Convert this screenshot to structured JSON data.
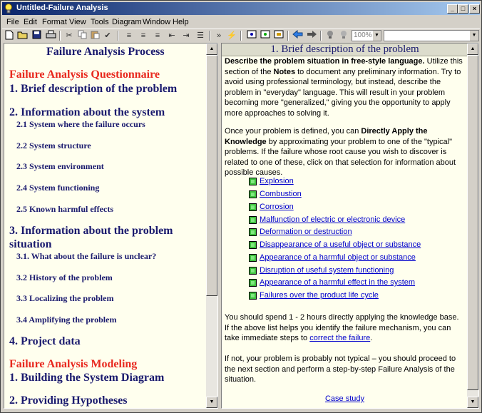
{
  "window": {
    "title": "Untitled-Failure Analysis",
    "minimize": "_",
    "maximize": "□",
    "close": "×"
  },
  "menu": [
    "File",
    "Edit",
    "Format",
    "View",
    "Tools",
    "Diagram",
    "Window",
    "Help"
  ],
  "toolbar": {
    "zoom_value": "100%",
    "search_value": "",
    "icons": [
      "new-icon",
      "open-icon",
      "save-icon",
      "print-icon",
      "cut-icon",
      "copy-icon",
      "paste-icon",
      "spellcheck-icon",
      "align-left-icon",
      "align-center-icon",
      "align-right-icon",
      "outdent-icon",
      "indent-icon",
      "bullets-icon",
      "forward-icon",
      "lightning-icon",
      "browse-icon",
      "browse-back-icon",
      "browse-next-icon",
      "back-arrow-icon",
      "forward-arrow-icon",
      "bulb-icon",
      "bulb-off-icon"
    ]
  },
  "left_pane": {
    "title": "Failure Analysis Process",
    "sections": [
      {
        "kind": "red",
        "text": "Failure Analysis Questionnaire"
      },
      {
        "kind": "sec",
        "text": "1. Brief description of the problem"
      },
      {
        "kind": "sec",
        "text": "2. Information about the system"
      },
      {
        "kind": "sub",
        "text": "2.1 System where the failure occurs"
      },
      {
        "kind": "sub",
        "text": "2.2 System structure"
      },
      {
        "kind": "sub",
        "text": "2.3 System environment"
      },
      {
        "kind": "sub",
        "text": "2.4 System functioning"
      },
      {
        "kind": "sub",
        "text": "2.5 Known harmful effects"
      },
      {
        "kind": "sec",
        "text": "3. Information about the problem"
      },
      {
        "kind": "sec",
        "text": "situation"
      },
      {
        "kind": "sub",
        "text": "3.1. What about the failure is unclear?"
      },
      {
        "kind": "sub",
        "text": "3.2 History of the problem"
      },
      {
        "kind": "sub",
        "text": "3.3 Localizing the problem"
      },
      {
        "kind": "sub",
        "text": "3.4 Amplifying the problem"
      },
      {
        "kind": "sec",
        "text": "4. Project data"
      },
      {
        "kind": "red",
        "text": "Failure Analysis Modeling"
      },
      {
        "kind": "sec",
        "text": "1. Building the System Diagram"
      },
      {
        "kind": "sec",
        "text": "2. Providing Hypotheses"
      }
    ]
  },
  "right_pane": {
    "header": "1. Brief description of the problem",
    "p1_bold": "Describe the problem situation in free-style language.",
    "p1_a": " Utilize this section of the ",
    "p1_notes": "Notes",
    "p1_b": " to document any preliminary information. Try to avoid using professional terminology, but instead, describe the problem in \"everyday\" language. This will result in your problem becoming more \"generalized,\" giving you the opportunity to apply more approaches to solving it.",
    "p2_a": "Once your problem is defined, you can ",
    "p2_bold": "Directly Apply the Knowledge",
    "p2_b": " by approximating your problem to one of the \"typical\" problems. If the failure whose root cause you wish to discover is related to one of these, click on that selection for information about possible causes.",
    "links": [
      "Explosion",
      "Combustion",
      "Corrosion",
      "Malfunction of electric or electronic device",
      "Deformation or destruction",
      "Disappearance of a useful object or substance",
      "Appearance of a harmful object or substance",
      "Disruption of useful system functioning",
      "Appearance of a harmful effect in the system",
      "Failures over the product life cycle"
    ],
    "p3_a": "You should spend 1 - 2 hours directly applying the knowledge base. If the above list helps you identify the failure mechanism, you can take immediate steps to ",
    "p3_link": "correct the failure",
    "p3_b": ".",
    "p4": "If not, your problem is probably not typical – you should proceed to the next section and perform a step-by-step Failure Analysis of the situation.",
    "case_study": "Case study"
  },
  "colors": {
    "pane_bg": "#ffffee",
    "heading_navy": "#1a1a6e",
    "heading_red": "#e8281e",
    "link_blue": "#0000cc",
    "link_icon_green": "#3dbf3d"
  }
}
